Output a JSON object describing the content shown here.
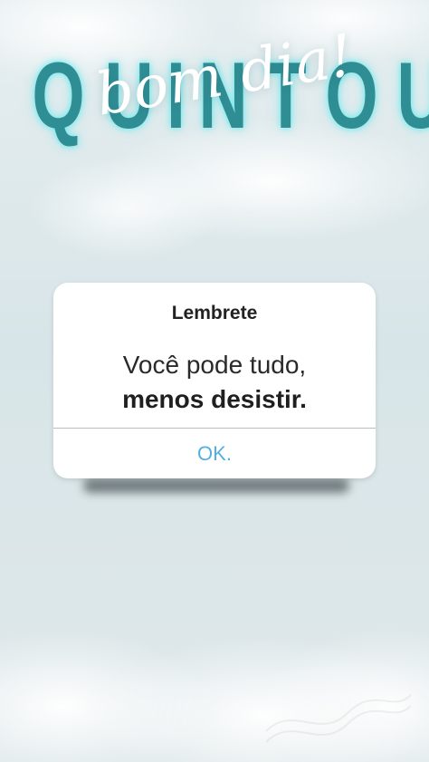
{
  "header": {
    "headline_letters": [
      "Q",
      "U",
      "I",
      "N",
      "T",
      "O",
      "U"
    ],
    "script_text": "bom dia!"
  },
  "dialog": {
    "title": "Lembrete",
    "line1": "Você pode tudo,",
    "line2": "menos desistir.",
    "ok_label": "OK."
  },
  "colors": {
    "background": "#d9e4e6",
    "headline": "#2f8d94",
    "accent": "#55aee0",
    "dialog_background": "#ffffff"
  }
}
